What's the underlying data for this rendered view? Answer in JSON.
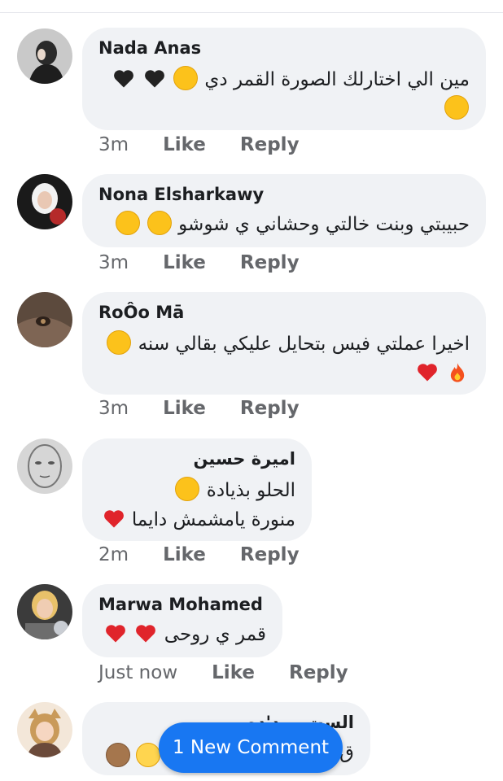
{
  "comments": [
    {
      "name": "Nada Anas",
      "text": "مين الي اختارلك الصورة القمر دي",
      "time": "3m",
      "like": "Like",
      "reply": "Reply"
    },
    {
      "name": "Nona Elsharkawy",
      "text": "حبيبتي وبنت خالتي وحشاني ي شوشو",
      "time": "3m",
      "like": "Like",
      "reply": "Reply"
    },
    {
      "name": "RoÔo Mā",
      "text": "اخيرا عملتي فيس بتحايل عليكي بقالي سنه",
      "time": "3m",
      "like": "Like",
      "reply": "Reply"
    },
    {
      "name": "اميرة حسين",
      "text1": "الحلو بذيادة",
      "text2": "منورة يامشمش دايما",
      "time": "2m",
      "like": "Like",
      "reply": "Reply"
    },
    {
      "name": "Marwa Mohamed",
      "text": "قمر ي روحى",
      "time": "Just now",
      "like": "Like",
      "reply": "Reply"
    },
    {
      "name": "الست ورد'ده",
      "text": "ق"
    }
  ],
  "new_comment_pill": "1 New Comment",
  "colors": {
    "accent": "#1877f2",
    "bubble": "#f0f2f5",
    "meta": "#65676b",
    "heart_red": "#e0242b",
    "heart_black": "#222222"
  }
}
